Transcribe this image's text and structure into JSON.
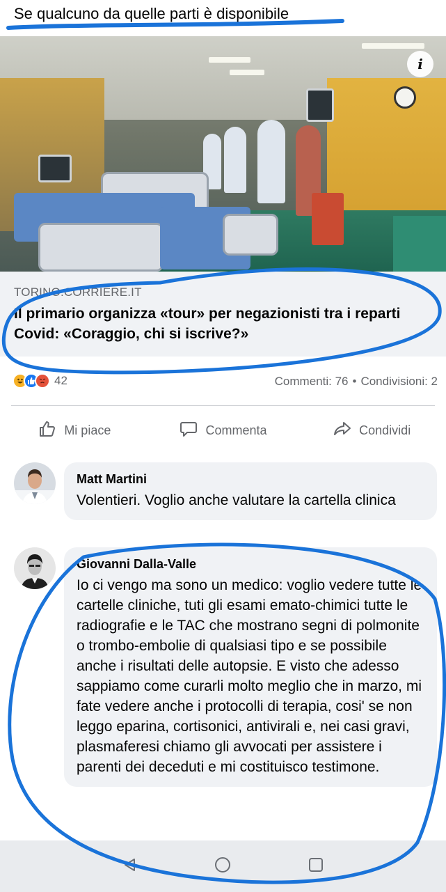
{
  "post": {
    "text": "Se qualcuno da quelle parti è disponibile"
  },
  "link_preview": {
    "info_icon": "i",
    "domain": "TORINO.CORRIERE.IT",
    "title": "Il primario organizza «tour» per negazionisti tra i reparti Covid: «Coraggio, chi si iscrive?»"
  },
  "stats": {
    "reaction_icons": [
      "haha-reaction-icon",
      "like-reaction-icon",
      "angry-reaction-icon"
    ],
    "reaction_count": "42",
    "comments": "Commenti: 76",
    "separator": "•",
    "shares": "Condivisioni: 2"
  },
  "actions": {
    "like": "Mi piace",
    "comment": "Commenta",
    "share": "Condividi"
  },
  "comments": [
    {
      "name": "Matt Martini",
      "text": "Volentieri. Voglio anche valutare la cartella clinica"
    },
    {
      "name": "Giovanni Dalla-Valle",
      "text": "Io ci vengo ma sono un medico: voglio vedere tutte le cartelle cliniche, tuti gli esami emato-chimici tutte le radiografie e le TAC che mostrano segni di polmonite o trombo-embolie di qualsiasi tipo e se possibile anche i risultati delle autopsie. E visto che adesso sappiamo come curarli molto meglio che in marzo, mi fate vedere anche i protocolli di terapia, cosi' se non leggo eparina, cortisonici, antivirali e, nei casi gravi, plasmaferesi chiamo gli avvocati per assistere i parenti dei deceduti e mi costituisco testimone."
    }
  ],
  "colors": {
    "annotation_blue": "#1a73d9",
    "bubble_bg": "#f0f2f5",
    "secondary_text": "#65676b"
  }
}
